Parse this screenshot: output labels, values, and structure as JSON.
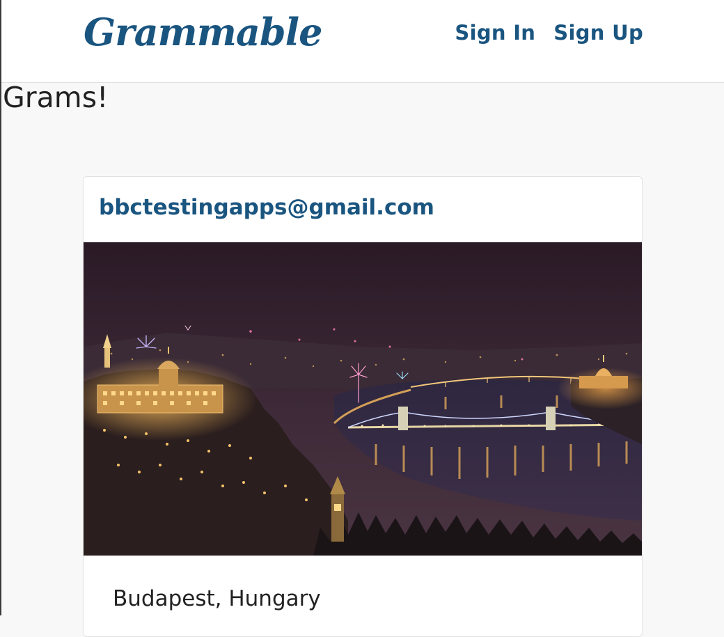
{
  "navbar": {
    "brand": "Grammable",
    "links": [
      "Sign In",
      "Sign Up"
    ]
  },
  "page": {
    "title": "Grams!"
  },
  "grams": [
    {
      "author": "bbctestingapps@gmail.com",
      "image": "budapest-night-cityscape",
      "caption": "Budapest, Hungary"
    }
  ],
  "colors": {
    "brand": "#1a5580",
    "page_background": "#f8f8f8",
    "card_background": "#ffffff",
    "text": "#222222"
  }
}
